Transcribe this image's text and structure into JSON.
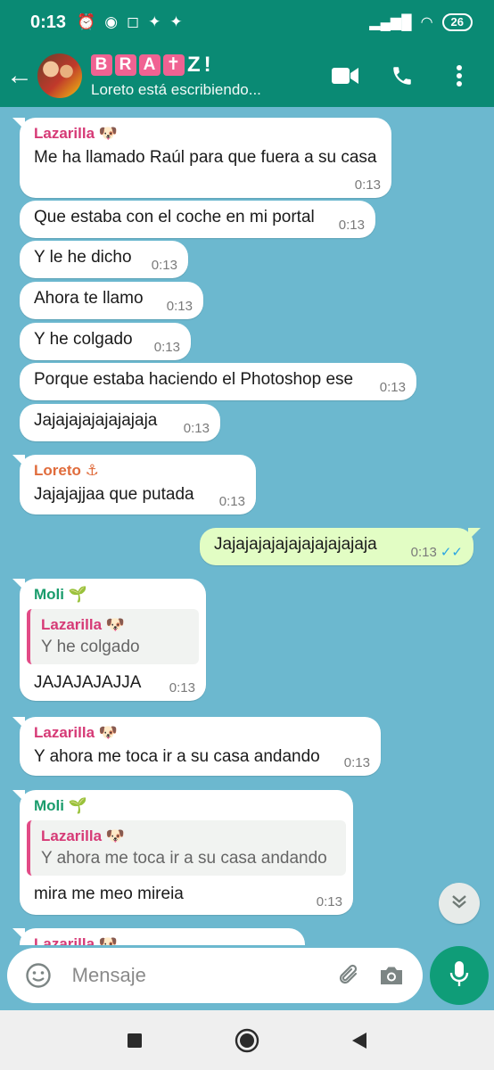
{
  "status_bar": {
    "time": "0:13",
    "battery": "26"
  },
  "header": {
    "title_parts": [
      "B",
      "R",
      "A",
      "✝",
      "Z",
      "!"
    ],
    "subtitle": "Loreto está escribiendo..."
  },
  "messages": [
    {
      "sender": "Lazarilla 🐶",
      "text": "Me ha llamado Raúl para que fuera a su casa",
      "time": "0:13"
    },
    {
      "text": "Que estaba con el coche en mi portal",
      "time": "0:13"
    },
    {
      "text": "Y le he dicho",
      "time": "0:13"
    },
    {
      "text": "Ahora te llamo",
      "time": "0:13"
    },
    {
      "text": "Y he colgado",
      "time": "0:13"
    },
    {
      "text": "Porque estaba haciendo el Photoshop ese",
      "time": "0:13"
    },
    {
      "text": "Jajajajajajajajaja",
      "time": "0:13"
    },
    {
      "sender": "Loreto ⚓",
      "text": "Jajajajjaa que putada",
      "time": "0:13"
    },
    {
      "text": "Jajajajajajajajajajajaja",
      "time": "0:13",
      "ticks": "✓✓"
    },
    {
      "sender": "Moli 🌱",
      "quote_sender": "Lazarilla 🐶",
      "quote_text": "Y he colgado",
      "text": "JAJAJAJAJJA",
      "time": "0:13"
    },
    {
      "sender": "Lazarilla 🐶",
      "text": "Y ahora me toca ir a su casa andando",
      "time": "0:13"
    },
    {
      "sender": "Moli 🌱",
      "quote_sender": "Lazarilla 🐶",
      "quote_text": "Y ahora me toca ir a su casa andando",
      "text": "mira me meo mireia",
      "time": "0:13"
    },
    {
      "sender": "Lazarilla 🐶"
    }
  ],
  "input": {
    "placeholder": "Mensaje"
  },
  "colors": {
    "header": "#0a8a74",
    "chat_bg": "#6cb8cf",
    "incoming": "#ffffff",
    "outgoing": "#e2fdc4",
    "sender_lazarilla": "#d63a76",
    "sender_loreto": "#e06c3c",
    "sender_moli": "#1a9c6c",
    "read_ticks": "#2aa5e2"
  },
  "icons": [
    "back-arrow-icon",
    "video-call-icon",
    "phone-icon",
    "more-options-icon",
    "emoji-icon",
    "attach-icon",
    "camera-icon",
    "mic-icon",
    "chevron-down-icon",
    "nav-square-icon",
    "nav-circle-icon",
    "nav-back-icon"
  ]
}
